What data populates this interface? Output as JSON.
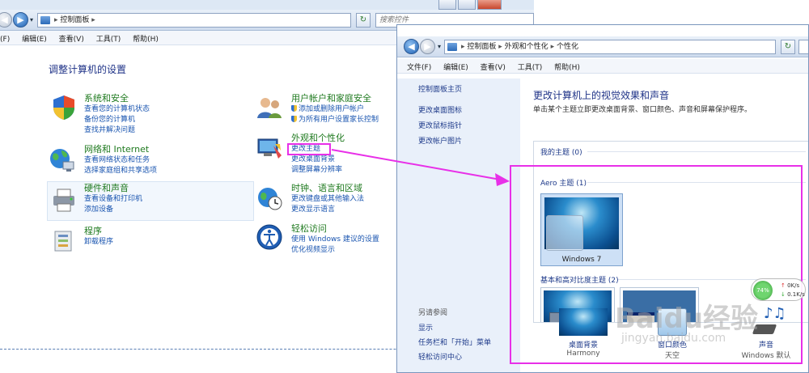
{
  "win1": {
    "address": "控制面板",
    "search_placeholder": "搜索控件",
    "menu": [
      "(F)",
      "编辑(E)",
      "查看(V)",
      "工具(T)",
      "帮助(H)"
    ],
    "heading": "调整计算机的设置",
    "categories": [
      {
        "title": "系统和安全",
        "links": [
          "查看您的计算机状态",
          "备份您的计算机",
          "查找并解决问题"
        ]
      },
      {
        "title": "网络和 Internet",
        "links": [
          "查看网络状态和任务",
          "选择家庭组和共享选项"
        ]
      },
      {
        "title": "硬件和声音",
        "links": [
          "查看设备和打印机",
          "添加设备"
        ]
      },
      {
        "title": "程序",
        "links": [
          "卸载程序"
        ]
      },
      {
        "title": "用户帐户和家庭安全",
        "links": [
          "添加或删除用户帐户",
          "为所有用户设置家长控制"
        ]
      },
      {
        "title": "外观和个性化",
        "links": [
          "更改主题",
          "更改桌面背景",
          "调整屏幕分辨率"
        ]
      },
      {
        "title": "时钟、语言和区域",
        "links": [
          "更改键盘或其他输入法",
          "更改显示语言"
        ]
      },
      {
        "title": "轻松访问",
        "links": [
          "使用 Windows 建议的设置",
          "优化视频显示"
        ]
      }
    ]
  },
  "win2": {
    "address": [
      "控制面板",
      "外观和个性化",
      "个性化"
    ],
    "menu": [
      "文件(F)",
      "编辑(E)",
      "查看(V)",
      "工具(T)",
      "帮助(H)"
    ],
    "sidebar_home": "控制面板主页",
    "sidebar_links": [
      "更改桌面图标",
      "更改鼠标指针",
      "更改帐户图片"
    ],
    "see_also": "另请参阅",
    "see_also_links": [
      "显示",
      "任务栏和「开始」菜单",
      "轻松访问中心"
    ],
    "title": "更改计算机上的视觉效果和声音",
    "subtitle": "单击某个主题立即更改桌面背景、窗口颜色、声音和屏幕保护程序。",
    "my_themes": "我的主题 (0)",
    "aero_themes": "Aero 主题 (1)",
    "theme_name": "Windows 7",
    "basic_themes": "基本和高对比度主题 (2)",
    "bottom_items": [
      {
        "label": "桌面背景",
        "sub": "Harmony"
      },
      {
        "label": "窗口颜色",
        "sub": "天空"
      },
      {
        "label": "声音",
        "sub": "Windows 默认"
      }
    ]
  },
  "net_widget": {
    "percent": "74%",
    "up": "0K/s",
    "down": "0.1K/s"
  },
  "watermark": {
    "brand": "Baidu经验",
    "url": "jingyan.baidu.com"
  },
  "colors": {
    "highlight": "#e830e8",
    "link": "#1a55b0",
    "category": "#1f7a1f",
    "heading": "#1e3287"
  }
}
